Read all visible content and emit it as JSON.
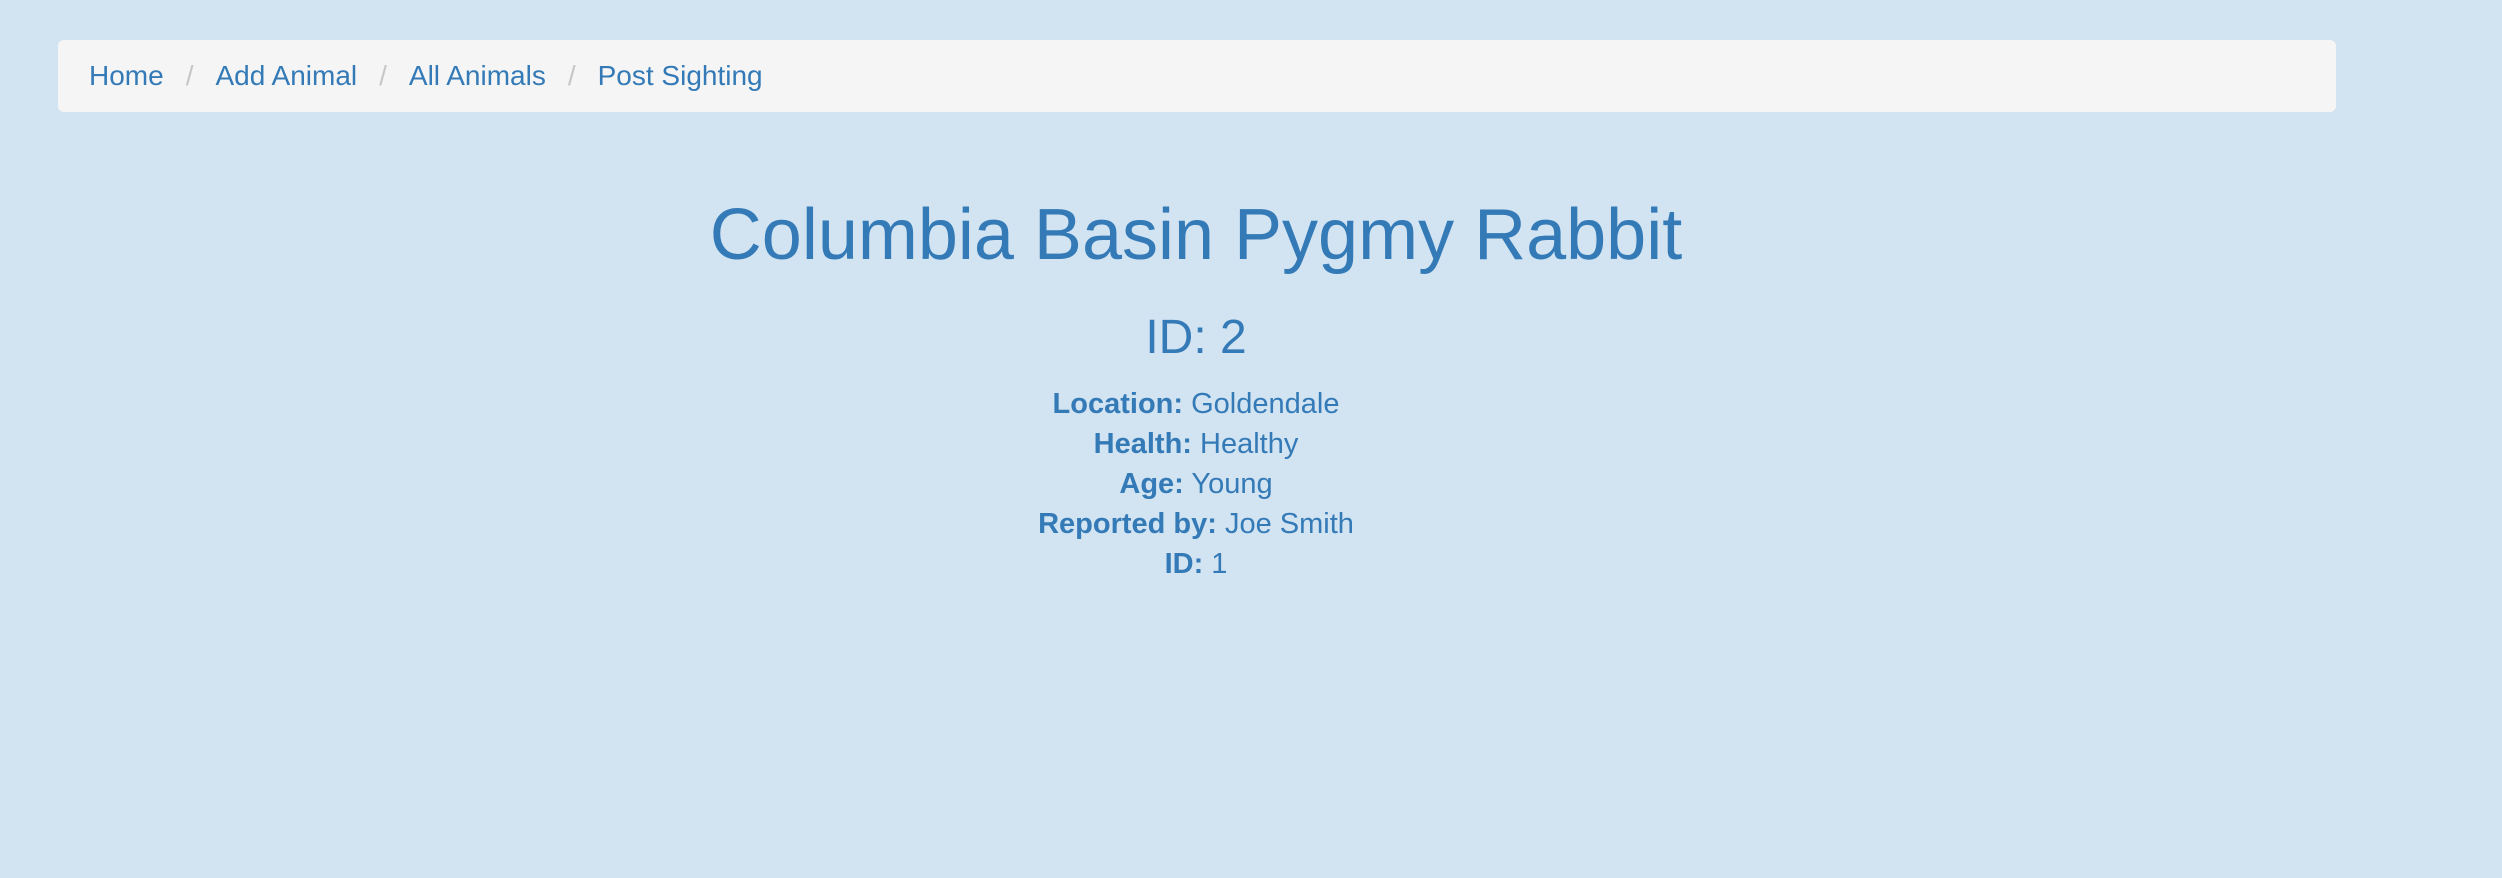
{
  "nav": {
    "items": [
      {
        "label": "Home"
      },
      {
        "label": "Add Animal"
      },
      {
        "label": "All Animals"
      },
      {
        "label": "Post Sighting"
      }
    ],
    "separator": "/"
  },
  "animal": {
    "name": "Columbia Basin Pygmy Rabbit",
    "id_line": "ID: 2"
  },
  "sighting": {
    "location_label": "Location:",
    "location": "Goldendale",
    "health_label": "Health:",
    "health": "Healthy",
    "age_label": "Age:",
    "age": "Young",
    "reporter_label": "Reported by:",
    "reporter": "Joe Smith",
    "id_label": "ID:",
    "id": "1"
  },
  "colors": {
    "background": "#d2e3f2",
    "text": "#337ab7",
    "breadcrumb_bg": "#f5f5f5"
  }
}
